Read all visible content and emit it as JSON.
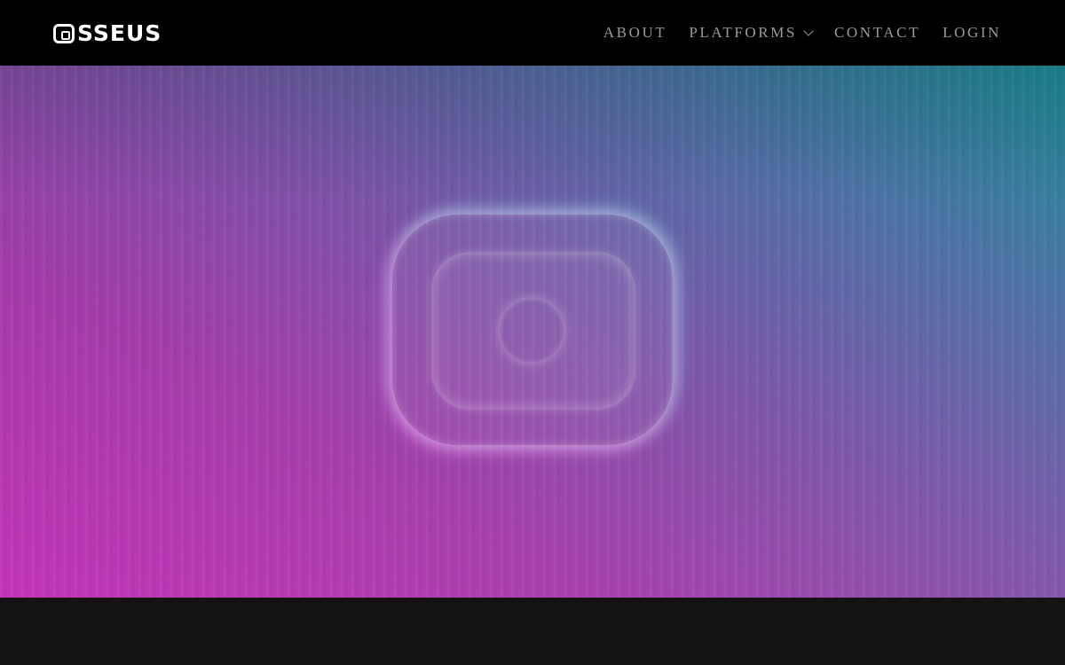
{
  "header": {
    "logo_text": "SSEUS",
    "nav": [
      {
        "label": "ABOUT",
        "has_dropdown": false
      },
      {
        "label": "PLATFORMS",
        "has_dropdown": true
      },
      {
        "label": "CONTACT",
        "has_dropdown": false
      },
      {
        "label": "LOGIN",
        "has_dropdown": false
      }
    ]
  },
  "hero": {
    "gradient_colors": [
      "#c02cb4",
      "#7a55a8",
      "#1d8e98"
    ],
    "emblem_icon": "osseus-camera-emblem-icon"
  },
  "colors": {
    "header_bg": "#000000",
    "nav_text": "#9a9a9a",
    "footer_bg": "#141213"
  }
}
